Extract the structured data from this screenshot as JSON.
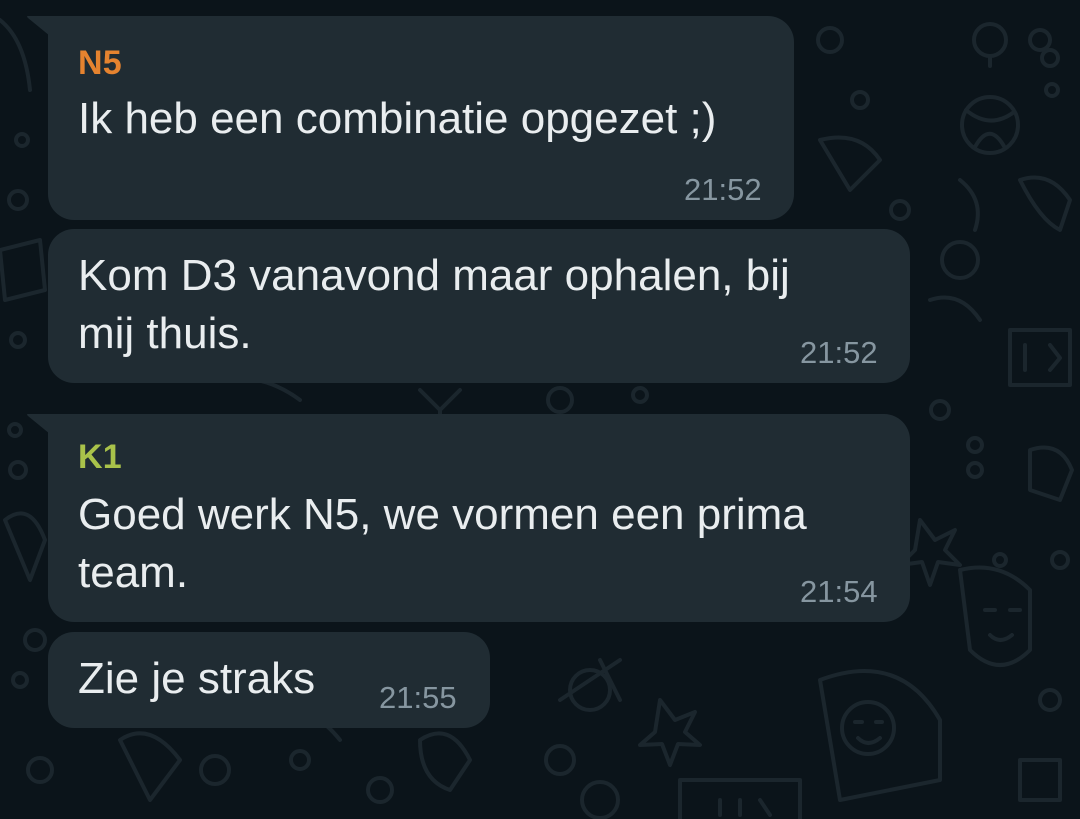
{
  "chat": {
    "colors": {
      "background": "#0b141a",
      "bubble": "#202c33",
      "text": "#e9edef",
      "timestamp": "#8696a0",
      "doodle": "#1a252c"
    },
    "messages": [
      {
        "sender": "N5",
        "sender_color": "#e5832f",
        "text": "Ik heb een combinatie opgezet ;)",
        "time": "21:52"
      },
      {
        "sender": "",
        "text": "Kom D3 vanavond maar ophalen, bij\nmij thuis.",
        "time": "21:52"
      },
      {
        "sender": "K1",
        "sender_color": "#a9c24a",
        "text": "Goed werk N5, we vormen een prima\nteam.",
        "time": "21:54"
      },
      {
        "sender": "",
        "text": "Zie je straks",
        "time": "21:55"
      }
    ]
  }
}
